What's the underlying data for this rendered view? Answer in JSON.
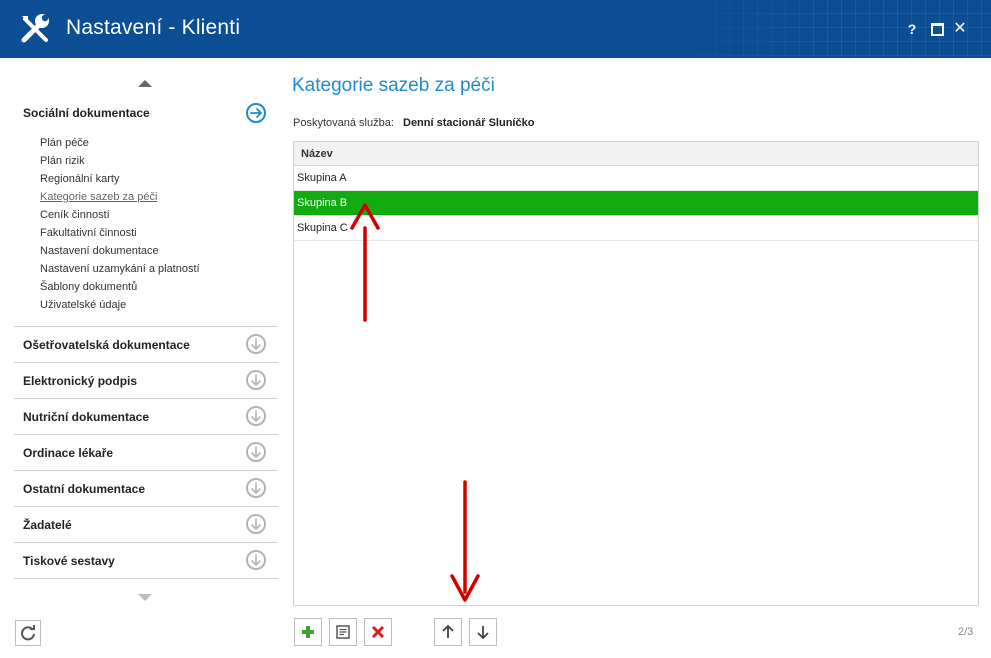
{
  "window": {
    "title": "Nastavení - Klienti",
    "icon": "wrench-screwdriver-icon",
    "help_label": "?",
    "close_label": "✕"
  },
  "sidebar": {
    "open_section": {
      "label": "Sociální dokumentace",
      "items": [
        {
          "label": "Plán péče"
        },
        {
          "label": "Plán rizik"
        },
        {
          "label": "Regionální karty"
        },
        {
          "label": "Kategorie sazeb za péči",
          "active": true
        },
        {
          "label": "Ceník činností"
        },
        {
          "label": "Fakultativní činnosti"
        },
        {
          "label": "Nastavení dokumentace"
        },
        {
          "label": "Nastavení uzamykání a platností"
        },
        {
          "label": "Šablony dokumentů"
        },
        {
          "label": "Uživatelské údaje"
        }
      ]
    },
    "sections": [
      {
        "label": "Ošetřovatelská dokumentace"
      },
      {
        "label": "Elektronický podpis"
      },
      {
        "label": "Nutriční dokumentace"
      },
      {
        "label": "Ordinace lékaře"
      },
      {
        "label": "Ostatní dokumentace"
      },
      {
        "label": "Žadatelé"
      },
      {
        "label": "Tiskové sestavy"
      }
    ]
  },
  "main": {
    "title": "Kategorie sazeb za péči",
    "service_label": "Poskytovaná služba:",
    "service_value": "Denní stacionář Sluníčko",
    "grid": {
      "column": "Název",
      "rows": [
        {
          "name": "Skupina A"
        },
        {
          "name": "Skupina B",
          "selected": true
        },
        {
          "name": "Skupina C"
        }
      ]
    },
    "pager": "2/3"
  },
  "colors": {
    "titlebar": "#0b4e93",
    "accent": "#1e8bcf",
    "selected_row": "#12ac10",
    "annotation": "#d00000"
  }
}
